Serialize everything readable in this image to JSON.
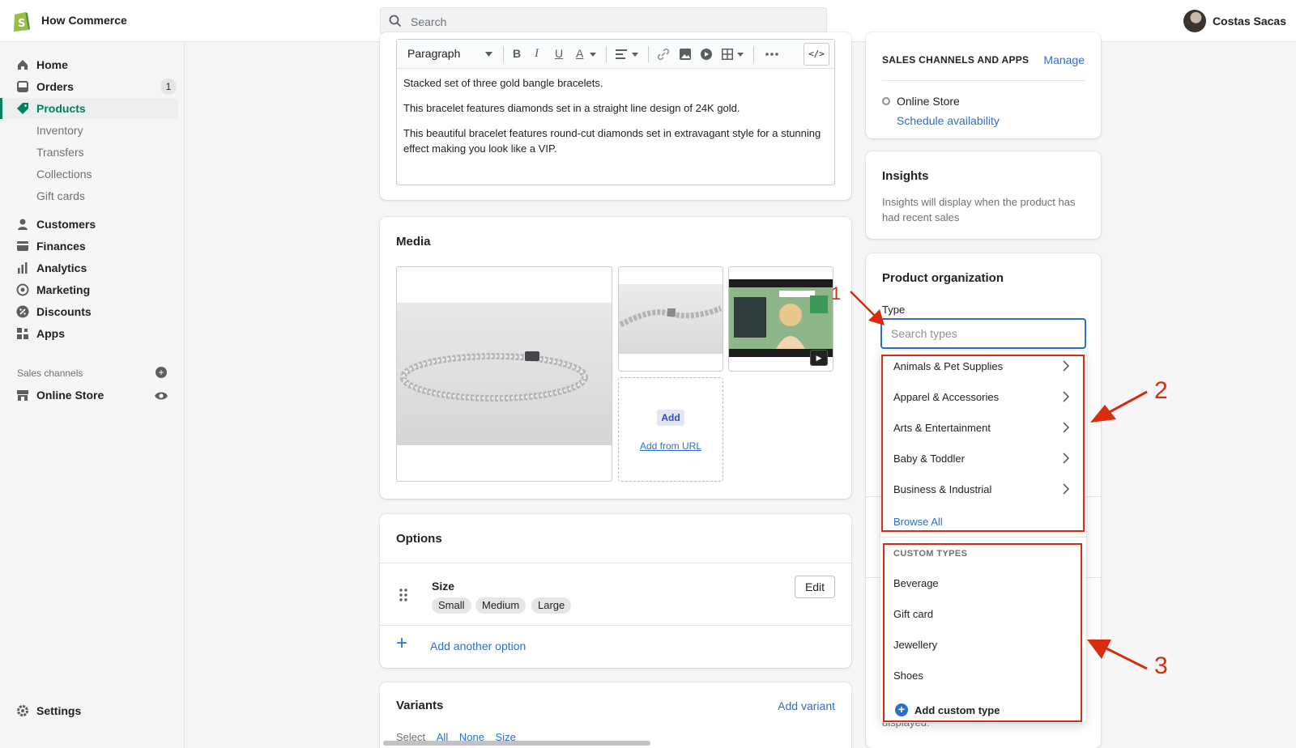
{
  "topbar": {
    "store_name": "How Commerce",
    "search_placeholder": "Search",
    "user_name": "Costas Sacas"
  },
  "sidebar": {
    "items": [
      {
        "label": "Home",
        "icon": "home-icon"
      },
      {
        "label": "Orders",
        "icon": "orders-icon",
        "badge": "1"
      },
      {
        "label": "Products",
        "icon": "tag-icon",
        "active": true
      },
      {
        "label": "Inventory"
      },
      {
        "label": "Transfers"
      },
      {
        "label": "Collections"
      },
      {
        "label": "Gift cards"
      },
      {
        "label": "Customers",
        "icon": "person-icon"
      },
      {
        "label": "Finances",
        "icon": "finances-icon"
      },
      {
        "label": "Analytics",
        "icon": "analytics-icon"
      },
      {
        "label": "Marketing",
        "icon": "marketing-icon"
      },
      {
        "label": "Discounts",
        "icon": "discount-icon"
      },
      {
        "label": "Apps",
        "icon": "apps-icon"
      },
      {
        "label": "Online Store",
        "icon": "store-icon"
      },
      {
        "label": "Settings",
        "icon": "gear-icon"
      }
    ],
    "sales_channels_label": "Sales channels"
  },
  "editor": {
    "format_select": "Paragraph",
    "code_button": "</>",
    "paragraphs": [
      "Stacked set of three gold bangle bracelets.",
      "This bracelet features diamonds set in a straight line design of 24K gold.",
      "This beautiful bracelet features round-cut diamonds set in extravagant style for a stunning effect making you look like a VIP."
    ]
  },
  "media": {
    "title": "Media",
    "add_label": "Add",
    "add_from_url": "Add from URL"
  },
  "options": {
    "title": "Options",
    "option_name": "Size",
    "values": [
      "Small",
      "Medium",
      "Large"
    ],
    "edit_label": "Edit",
    "add_another": "Add another option"
  },
  "variants": {
    "title": "Variants",
    "add_variant": "Add variant",
    "select_label": "Select",
    "select_all": "All",
    "select_none": "None",
    "select_size": "Size"
  },
  "channels": {
    "title": "SALES CHANNELS AND APPS",
    "manage": "Manage",
    "online_store": "Online Store",
    "schedule": "Schedule availability"
  },
  "insights": {
    "title": "Insights",
    "text": "Insights will display when the product has had recent sales"
  },
  "product_organization": {
    "title": "Product organization",
    "type_label": "Type",
    "type_placeholder": "Search types",
    "behind_text": "displayed."
  },
  "type_dropdown": {
    "categories": [
      "Animals & Pet Supplies",
      "Apparel & Accessories",
      "Arts & Entertainment",
      "Baby & Toddler",
      "Business & Industrial"
    ],
    "browse_all": "Browse All",
    "custom_section": "CUSTOM TYPES",
    "custom_types": [
      "Beverage",
      "Gift card",
      "Jewellery",
      "Shoes"
    ],
    "add_custom": "Add custom type"
  },
  "annotations": {
    "one": "1",
    "two": "2",
    "three": "3",
    "color": "#d72c0d"
  },
  "colors": {
    "accent_green": "#008060",
    "link_blue": "#2c6ecb"
  }
}
